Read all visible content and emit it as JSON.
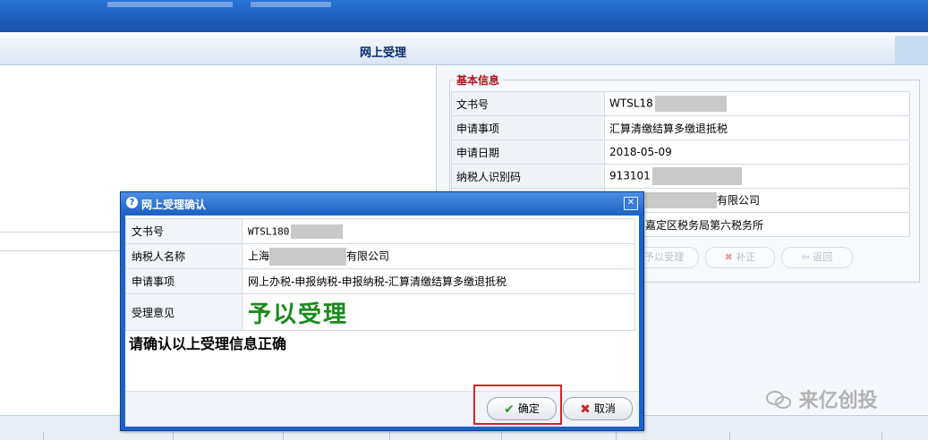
{
  "header": {
    "title": "网上受理"
  },
  "basic_info": {
    "legend": "基本信息",
    "rows": [
      {
        "label": "文书号",
        "value": "WTSL18"
      },
      {
        "label": "申请事项",
        "value": "汇算清缴结算多缴退抵税"
      },
      {
        "label": "申请日期",
        "value": "2018-05-09"
      },
      {
        "label": "纳税人识别码",
        "value": "913101"
      },
      {
        "label": "",
        "value": "有限公司"
      },
      {
        "label": "",
        "value": "嘉定区税务局第六税务所"
      }
    ],
    "buttons": {
      "accept": "予以受理",
      "supplement": "补正",
      "back": "返回"
    }
  },
  "dialog": {
    "title": "网上受理确认",
    "rows": [
      {
        "label": "文书号",
        "value": "WTSL180"
      },
      {
        "label": "纳税人名称",
        "value_prefix": "上海",
        "value_suffix": "有限公司"
      },
      {
        "label": "申请事项",
        "value": "网上办税-申报纳税-申报纳税-汇算清缴结算多缴退抵税"
      },
      {
        "label": "受理意见",
        "value": "予以受理"
      }
    ],
    "confirm_text": "请确认以上受理信息正确",
    "ok_label": "确定",
    "cancel_label": "取消"
  },
  "watermark": {
    "text": "来亿创投"
  },
  "colors": {
    "accent_red": "#d0262b",
    "ok_green": "#1a8a1a",
    "header_blue": "#1f5fbf"
  }
}
